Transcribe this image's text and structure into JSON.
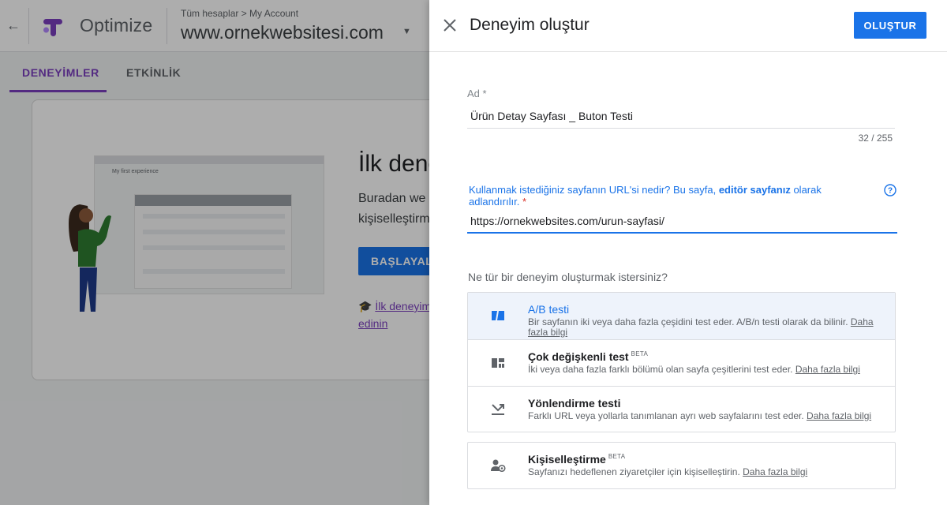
{
  "background_app": {
    "product_name": "Optimize",
    "account_crumb": "Tüm hesaplar > My Account",
    "account_name": "www.ornekwebsitesi.com",
    "tabs": [
      {
        "label": "DENEYİMLER",
        "active": true
      },
      {
        "label": "ETKİNLİK",
        "active": false
      }
    ],
    "card": {
      "mini_title": "My first experience",
      "title": "İlk dene",
      "desc_line1": "Buradan we",
      "desc_line2": "kişiselleştirm",
      "button_label": "BAŞLAYALI",
      "link_line1": "İlk deneyim",
      "link_line2": "edinin"
    }
  },
  "dialog": {
    "title": "Deneyim oluştur",
    "create_label": "OLUŞTUR",
    "name_field": {
      "label": "Ad *",
      "value": "Ürün Detay Sayfası _ Buton Testi",
      "counter": "32 / 255"
    },
    "url_field": {
      "label_before": "Kullanmak istediğiniz sayfanın URL'si nedir? Bu sayfa, ",
      "label_bold": "editör sayfanız",
      "label_after": " olarak adlandırılır. ",
      "required_mark": "*",
      "value": "https://ornekwebsites.com/urun-sayfasi/"
    },
    "type_question": "Ne tür bir deneyim oluşturmak istersiniz?",
    "types": [
      {
        "icon": "ab-test-icon",
        "title": "A/B testi",
        "beta": "",
        "desc": "Bir sayfanın iki veya daha fazla çeşidini test eder. A/B/n testi olarak da bilinir. ",
        "more": "Daha fazla bilgi",
        "selected": true
      },
      {
        "icon": "multivariate-icon",
        "title": "Çok değişkenli test",
        "beta": "BETA",
        "desc": "İki veya daha fazla farklı bölümü olan sayfa çeşitlerini test eder. ",
        "more": "Daha fazla bilgi",
        "selected": false
      },
      {
        "icon": "redirect-icon",
        "title": "Yönlendirme testi",
        "beta": "",
        "desc": "Farklı URL veya yollarla tanımlanan ayrı web sayfalarını test eder. ",
        "more": "Daha fazla bilgi",
        "selected": false
      },
      {
        "icon": "personalization-icon",
        "title": "Kişiselleştirme",
        "beta": "BETA",
        "desc": "Sayfanızı hedeflenen ziyaretçiler için kişiselleştirin. ",
        "more": "Daha fazla bilgi",
        "selected": false
      }
    ]
  },
  "colors": {
    "accent_blue": "#1a73e8",
    "optimize_purple": "#7b3fbf",
    "selected_bg": "#eef3fb"
  }
}
